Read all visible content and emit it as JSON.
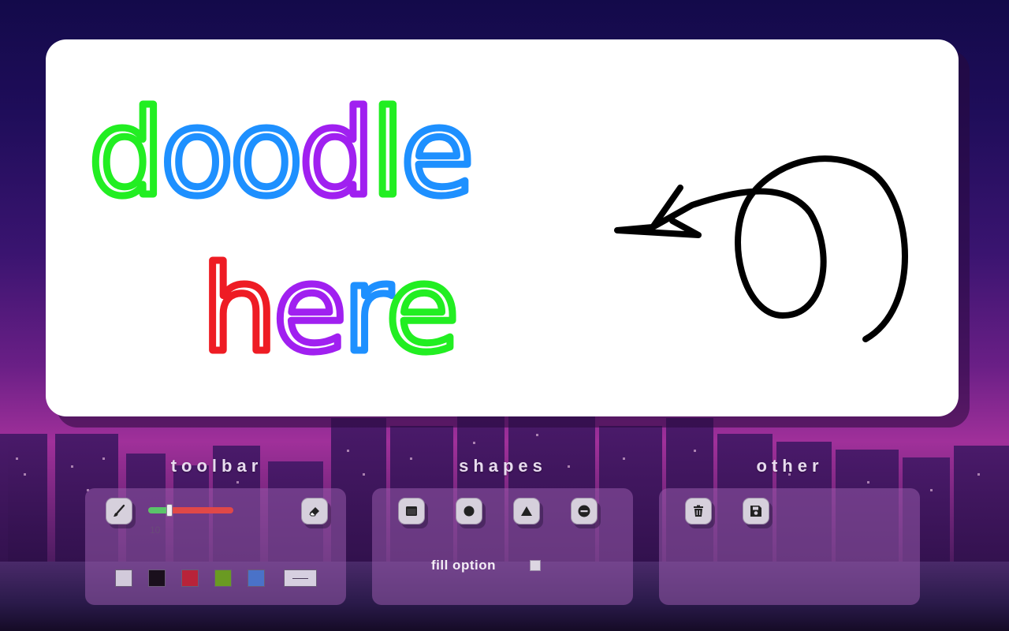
{
  "canvas": {
    "doodle_text_line1": "doodle",
    "doodle_text_line2": "here",
    "line1_colors": [
      "#22ee22",
      "#1e90ff",
      "#1e90ff",
      "#a020f0",
      "#22ee22",
      "#1e90ff"
    ],
    "line2_colors": [
      "#ee1c24",
      "#a020f0",
      "#1e90ff",
      "#22ee22"
    ]
  },
  "sections": {
    "toolbar_title": "toolbar",
    "shapes_title": "shapes",
    "other_title": "other"
  },
  "toolbar": {
    "brush_icon": "brush-icon",
    "eraser_icon": "eraser-icon",
    "brush_size": "10",
    "brush_size_fraction": 0.25,
    "swatches": [
      "#d2cadb",
      "#1a0f1c",
      "#b8233a",
      "#6a9a22",
      "#4a72c8"
    ],
    "line_style_icon": "line-style-icon"
  },
  "shapes": {
    "tools": [
      "rectangle-icon",
      "circle-icon",
      "triangle-icon",
      "line-icon"
    ],
    "fill_option_label": "fill option",
    "fill_checked": false
  },
  "other": {
    "tools": [
      "trash-icon",
      "save-icon"
    ]
  }
}
